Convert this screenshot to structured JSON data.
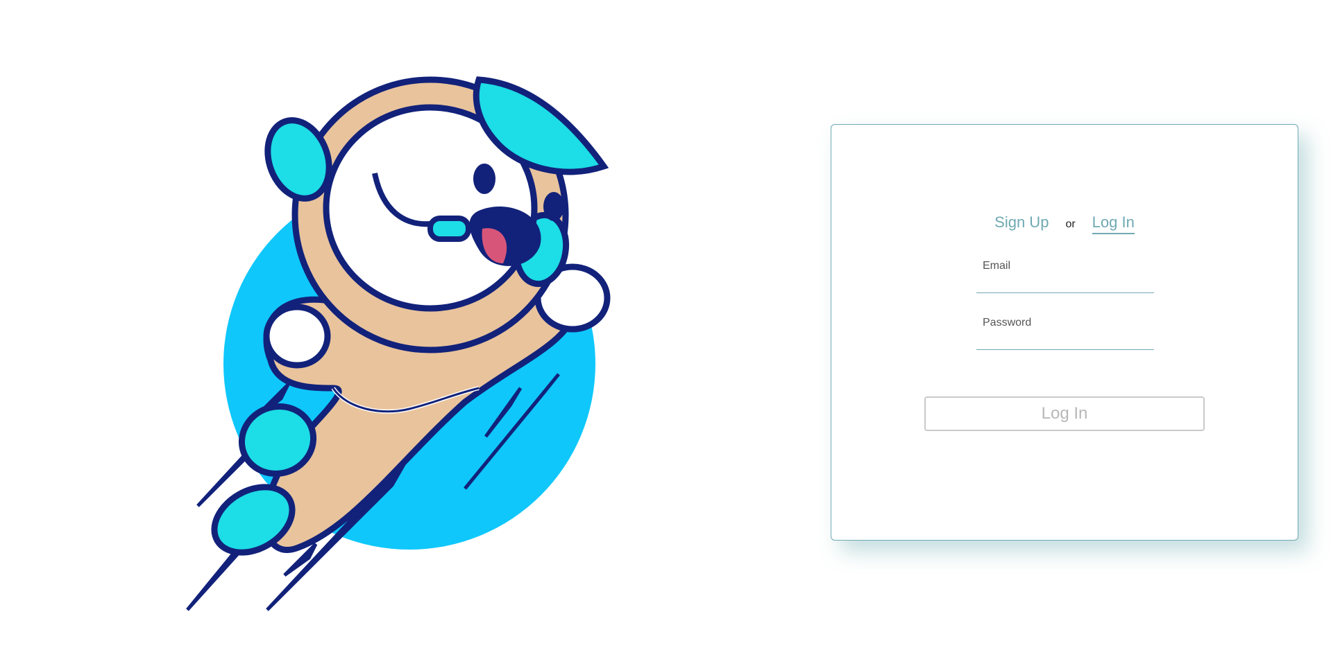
{
  "illustration": {
    "icon": "astronaut-mascot-icon",
    "colors": {
      "circle": "#0fc7fb",
      "suit": "#e8c39c",
      "suit_shadow": "#c8a888",
      "outline": "#12227a",
      "cyan": "#1ddde6",
      "white": "#ffffff",
      "tongue": "#d8557a"
    }
  },
  "auth": {
    "tabs": [
      {
        "label": "Sign Up",
        "active": false
      },
      {
        "label": "Log In",
        "active": true
      }
    ],
    "separator": "or",
    "email_label": "Email",
    "email_value": "",
    "password_label": "Password",
    "password_value": "",
    "submit_label": "Log In"
  },
  "colors": {
    "accent": "#6fa9b2",
    "button_border": "#c9c9c9",
    "button_text": "#b8b8b8"
  }
}
